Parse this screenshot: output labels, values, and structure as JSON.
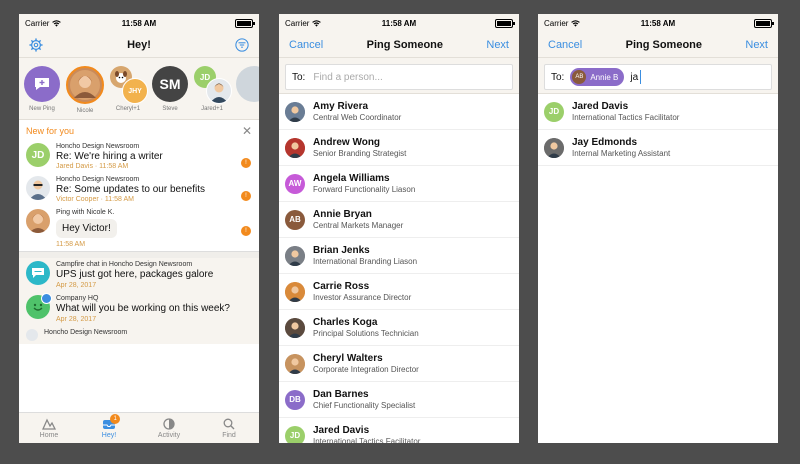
{
  "status": {
    "carrier": "Carrier",
    "time": "11:58 AM"
  },
  "phone1": {
    "title": "Hey!",
    "stories": [
      {
        "label": "New Ping",
        "initials": "",
        "color": "#8b6cc9"
      },
      {
        "label": "Nicole",
        "initials": "",
        "color": "#c98a5a"
      },
      {
        "label": "Cheryl+1",
        "initials": "JHY",
        "color": "#f2b24d"
      },
      {
        "label": "Steve",
        "initials": "SM",
        "color": "#444444"
      },
      {
        "label": "Jared+1",
        "initials": "JD",
        "color": "#9bcf6a"
      }
    ],
    "new_for_you": "New for you",
    "feed": [
      {
        "source": "Honcho Design Newsroom",
        "subject": "Re: We're hiring a writer",
        "meta": "Jared Davis · 11:58 AM",
        "initials": "JD",
        "color": "#9bcf6a"
      },
      {
        "source": "Honcho Design Newsroom",
        "subject": "Re: Some updates to our benefits",
        "meta": "Victor Cooper · 11:58 AM",
        "initials": "",
        "color": "#cfd6dc"
      },
      {
        "source": "Ping with Nicole K.",
        "subject": "Hey Victor!",
        "meta": "11:58 AM",
        "initials": "",
        "color": "#c98a5a"
      }
    ],
    "chats": [
      {
        "source": "Campfire chat in Honcho Design Newsroom",
        "message": "UPS just got here, packages galore",
        "date": "Apr 28, 2017",
        "color": "#2cb8c8"
      },
      {
        "source": "Company HQ",
        "message": "What will you be working on this week?",
        "date": "Apr 28, 2017",
        "color": "#4fc26a"
      },
      {
        "source": "Honcho Design Newsroom",
        "message": "",
        "date": "",
        "color": "#3b8ee0"
      }
    ],
    "tabs": [
      {
        "label": "Home",
        "badge": ""
      },
      {
        "label": "Hey!",
        "badge": "1"
      },
      {
        "label": "Activity",
        "badge": ""
      },
      {
        "label": "Find",
        "badge": ""
      }
    ]
  },
  "phone2": {
    "title": "Ping Someone",
    "cancel": "Cancel",
    "next": "Next",
    "to_label": "To:",
    "placeholder": "Find a person...",
    "people": [
      {
        "name": "Amy Rivera",
        "title": "Central Web Coordinator",
        "initials": "",
        "color": "#6a7d95"
      },
      {
        "name": "Andrew Wong",
        "title": "Senior Branding Strategist",
        "initials": "",
        "color": "#b5362e"
      },
      {
        "name": "Angela Williams",
        "title": "Forward Functionality Liason",
        "initials": "AW",
        "color": "#c65ad8"
      },
      {
        "name": "Annie Bryan",
        "title": "Central Markets Manager",
        "initials": "AB",
        "color": "#8a5a3c"
      },
      {
        "name": "Brian Jenks",
        "title": "International Branding Liason",
        "initials": "",
        "color": "#7a7f86"
      },
      {
        "name": "Carrie Ross",
        "title": "Investor Assurance Director",
        "initials": "",
        "color": "#d98a3a"
      },
      {
        "name": "Charles Koga",
        "title": "Principal Solutions Technician",
        "initials": "",
        "color": "#5b4a3e"
      },
      {
        "name": "Cheryl Walters",
        "title": "Corporate Integration Director",
        "initials": "",
        "color": "#c7935f"
      },
      {
        "name": "Dan Barnes",
        "title": "Chief Functionality Specialist",
        "initials": "DB",
        "color": "#8b6cc9"
      },
      {
        "name": "Jared Davis",
        "title": "International Tactics Facilitator",
        "initials": "JD",
        "color": "#9bcf6a"
      }
    ]
  },
  "phone3": {
    "title": "Ping Someone",
    "cancel": "Cancel",
    "next": "Next",
    "to_label": "To:",
    "chip_initials": "AB",
    "chip_name": "Annie B",
    "query": "ja",
    "people": [
      {
        "name": "Jared Davis",
        "title": "International Tactics Facilitator",
        "initials": "JD",
        "color": "#9bcf6a"
      },
      {
        "name": "Jay Edmonds",
        "title": "Internal Marketing Assistant",
        "initials": "",
        "color": "#6b6b6b"
      }
    ]
  }
}
